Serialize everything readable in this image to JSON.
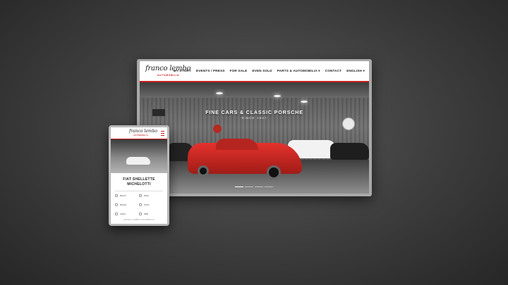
{
  "desktop": {
    "logo": "franco lembo",
    "logo_sub": "AUTOMOBILIA",
    "menu": [
      "MY STORY",
      "EVENTS / PRESS",
      "FOR SALE",
      "EVEN SOLD",
      "PARTS & AUTOMOBILIA ▾",
      "CONTACT",
      "ENGLISH ▾"
    ],
    "hero_title": "FINE CARS & CLASSIC PORSCHE",
    "hero_sub": "SINCE 1997"
  },
  "tablet": {
    "logo": "franco lembo",
    "logo_sub": "AUTOMOBILIA",
    "title_line1": "FIAT SHELLETTE",
    "title_line2": "MICHELOTTI",
    "specs": [
      "Benzin",
      "Weiß",
      "Manuel",
      "Frisch",
      "Cabrio",
      "3960"
    ],
    "footer": "FRANCO LEMBO AUTOMOBILIA"
  },
  "colors": {
    "accent": "#c81d1d",
    "car_red": "#d42a25"
  }
}
